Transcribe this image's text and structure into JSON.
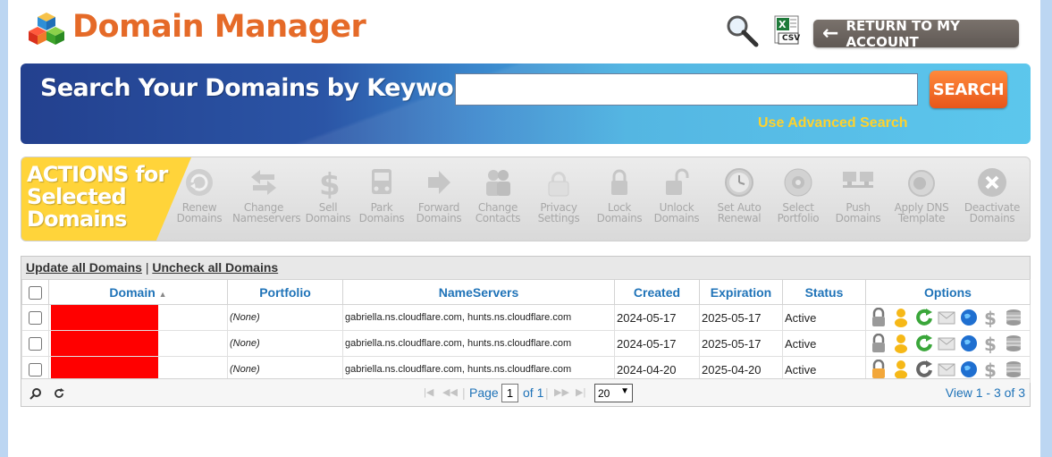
{
  "header": {
    "title": "Domain Manager",
    "csv_label": "CSV",
    "return_label": "RETURN TO MY ACCOUNT"
  },
  "search": {
    "banner_title": "Search Your Domains by Keyword",
    "input_value": "",
    "button_label": "SEARCH",
    "advanced_label": "Use Advanced Search"
  },
  "actions": {
    "title": "ACTIONS for\nSelected\nDomains",
    "items": [
      {
        "label": "Renew\nDomains",
        "icon": "renew-icon"
      },
      {
        "label": "Change\nNameservers",
        "icon": "nameservers-icon"
      },
      {
        "label": "Sell\nDomains",
        "icon": "dollar-icon"
      },
      {
        "label": "Park\nDomains",
        "icon": "park-icon"
      },
      {
        "label": "Forward\nDomains",
        "icon": "forward-arrow-icon"
      },
      {
        "label": "Change\nContacts",
        "icon": "contacts-icon"
      },
      {
        "label": "Privacy\nSettings",
        "icon": "privacy-icon"
      },
      {
        "label": "Lock\nDomains",
        "icon": "lock-icon"
      },
      {
        "label": "Unlock\nDomains",
        "icon": "unlock-icon"
      },
      {
        "label": "Set Auto\nRenewal",
        "icon": "clock-icon"
      },
      {
        "label": "Select\nPortfolio",
        "icon": "portfolio-icon"
      },
      {
        "label": "Push\nDomains",
        "icon": "push-icon"
      },
      {
        "label": "Apply DNS\nTemplate",
        "icon": "dns-template-icon"
      },
      {
        "label": "Deactivate\nDomains",
        "icon": "deactivate-icon"
      }
    ]
  },
  "grid": {
    "update_all": "Update all Domains",
    "separator": "|",
    "uncheck_all": "Uncheck all Domains",
    "columns": {
      "domain": "Domain",
      "portfolio": "Portfolio",
      "nameservers": "NameServers",
      "created": "Created",
      "expiration": "Expiration",
      "status": "Status",
      "options": "Options"
    },
    "rows": [
      {
        "portfolio": "(None)",
        "nameservers": "gabriella.ns.cloudflare.com, hunts.ns.cloudflare.com",
        "created": "2024-05-17",
        "expiration": "2025-05-17",
        "status": "Active",
        "locked": false,
        "renew_color": "#3aa63a"
      },
      {
        "portfolio": "(None)",
        "nameservers": "gabriella.ns.cloudflare.com, hunts.ns.cloudflare.com",
        "created": "2024-05-17",
        "expiration": "2025-05-17",
        "status": "Active",
        "locked": false,
        "renew_color": "#3aa63a"
      },
      {
        "portfolio": "(None)",
        "nameservers": "gabriella.ns.cloudflare.com, hunts.ns.cloudflare.com",
        "created": "2024-04-20",
        "expiration": "2025-04-20",
        "status": "Active",
        "locked": true,
        "renew_color": "#666666"
      }
    ],
    "footer": {
      "page_label": "Page",
      "page_value": "1",
      "of_label": "of 1",
      "rows_per_page": "20",
      "view_label": "View 1 - 3 of 3"
    }
  },
  "colors": {
    "title_orange": "#e56a28",
    "link_blue": "#1f73b8",
    "redaction_red": "#ff0000",
    "advanced_yellow": "#ffd22c"
  }
}
